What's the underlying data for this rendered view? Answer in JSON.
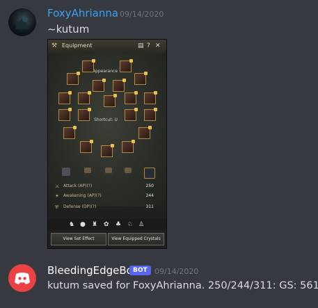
{
  "messages": [
    {
      "username": "FoxyAhrianna",
      "timestamp": "09/14/2020",
      "content": "~kutum",
      "name_color": "#3aa3f5"
    },
    {
      "username": "BleedingEdgeBot",
      "badge": "BOT",
      "timestamp": "09/14/2020",
      "content": "kutum saved for FoxyAhrianna. 250/244/311: GS: 561",
      "name_color": "#ffffff"
    }
  ],
  "attachment": {
    "title": "Equipment",
    "section_appearance": "Appearance",
    "shortcut_label": "Shortcut: U",
    "stats": [
      {
        "label": "Attack (AP)(?)",
        "value": "250",
        "icon": "sword-icon"
      },
      {
        "label": "Awakening (AP)(?)",
        "value": "244",
        "icon": "awakening-icon"
      },
      {
        "label": "Defense (DP)(?)",
        "value": "311",
        "icon": "shield-icon"
      }
    ],
    "buttons": {
      "set_effect": "View Set Effect",
      "crystals": "View Equipped Crystals"
    },
    "window_controls": [
      "document-icon",
      "help-icon",
      "close-icon"
    ]
  },
  "colors": {
    "background": "#36393f",
    "bot_badge": "#5865f2",
    "discord_red": "#ed4245"
  }
}
